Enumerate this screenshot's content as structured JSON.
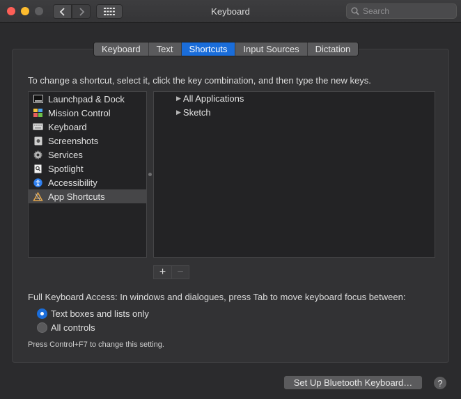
{
  "window": {
    "title": "Keyboard",
    "search_placeholder": "Search"
  },
  "tabs": [
    {
      "label": "Keyboard",
      "active": false
    },
    {
      "label": "Text",
      "active": false
    },
    {
      "label": "Shortcuts",
      "active": true
    },
    {
      "label": "Input Sources",
      "active": false
    },
    {
      "label": "Dictation",
      "active": false
    }
  ],
  "instructions": "To change a shortcut, select it, click the key combination, and then type the new keys.",
  "categories": [
    {
      "label": "Launchpad & Dock",
      "icon": "launchpad-dock-icon"
    },
    {
      "label": "Mission Control",
      "icon": "mission-control-icon"
    },
    {
      "label": "Keyboard",
      "icon": "keyboard-icon"
    },
    {
      "label": "Screenshots",
      "icon": "screenshots-icon"
    },
    {
      "label": "Services",
      "icon": "gear-icon"
    },
    {
      "label": "Spotlight",
      "icon": "spotlight-icon"
    },
    {
      "label": "Accessibility",
      "icon": "accessibility-icon"
    },
    {
      "label": "App Shortcuts",
      "icon": "app-shortcuts-icon",
      "selected": true
    }
  ],
  "shortcut_groups": [
    {
      "label": "All Applications"
    },
    {
      "label": "Sketch"
    }
  ],
  "buttons": {
    "add": "+",
    "remove": "−",
    "bluetooth": "Set Up Bluetooth Keyboard…",
    "help": "?"
  },
  "full_keyboard_access": {
    "label": "Full Keyboard Access: In windows and dialogues, press Tab to move keyboard focus between:",
    "options": [
      {
        "label": "Text boxes and lists only",
        "selected": true
      },
      {
        "label": "All controls",
        "selected": false
      }
    ],
    "hint": "Press Control+F7 to change this setting."
  },
  "colors": {
    "accent": "#1a6dda",
    "close": "#fe5f57",
    "minimize": "#febc2e"
  }
}
